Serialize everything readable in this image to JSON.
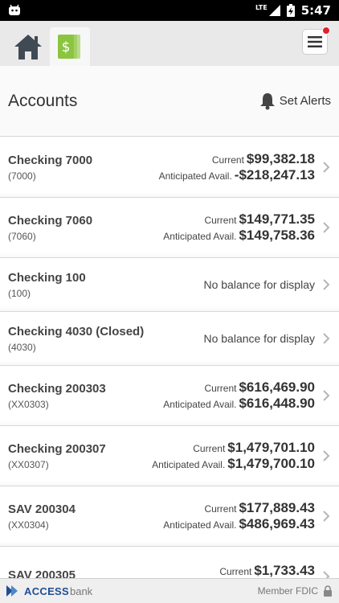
{
  "status_bar": {
    "network": "LTE",
    "time": "5:47"
  },
  "nav": {
    "tabs": [
      {
        "icon": "home-icon"
      },
      {
        "icon": "dollar-icon"
      }
    ],
    "menu_icon": "hamburger-icon"
  },
  "header": {
    "title": "Accounts",
    "set_alerts": "Set Alerts"
  },
  "labels": {
    "current": "Current",
    "anticipated": "Anticipated Avail.",
    "no_balance": "No balance for display"
  },
  "accounts": [
    {
      "name": "Checking 7000",
      "number": "(7000)",
      "current": "$99,382.18",
      "anticipated": "-$218,247.13"
    },
    {
      "name": "Checking 7060",
      "number": "(7060)",
      "current": "$149,771.35",
      "anticipated": "$149,758.36"
    },
    {
      "name": "Checking 100",
      "number": "(100)"
    },
    {
      "name": "Checking 4030 (Closed)",
      "number": "(4030)"
    },
    {
      "name": "Checking 200303",
      "number": "(XX0303)",
      "current": "$616,469.90",
      "anticipated": "$616,448.90"
    },
    {
      "name": "Checking 200307",
      "number": "(XX0307)",
      "current": "$1,479,701.10",
      "anticipated": "$1,479,700.10"
    },
    {
      "name": "SAV 200304",
      "number": "(XX0304)",
      "current": "$177,889.43",
      "anticipated": "$486,969.43"
    },
    {
      "name": "SAV 200305",
      "number": "",
      "current": "$1,733.43",
      "anticipated": ""
    }
  ],
  "footer": {
    "brand_bold": "ACCESS",
    "brand_light": "bank",
    "fdic": "Member FDIC"
  },
  "colors": {
    "brand_blue": "#1f4e96",
    "dollar_green": "#8bc53f",
    "alert_red": "#e0212f"
  }
}
